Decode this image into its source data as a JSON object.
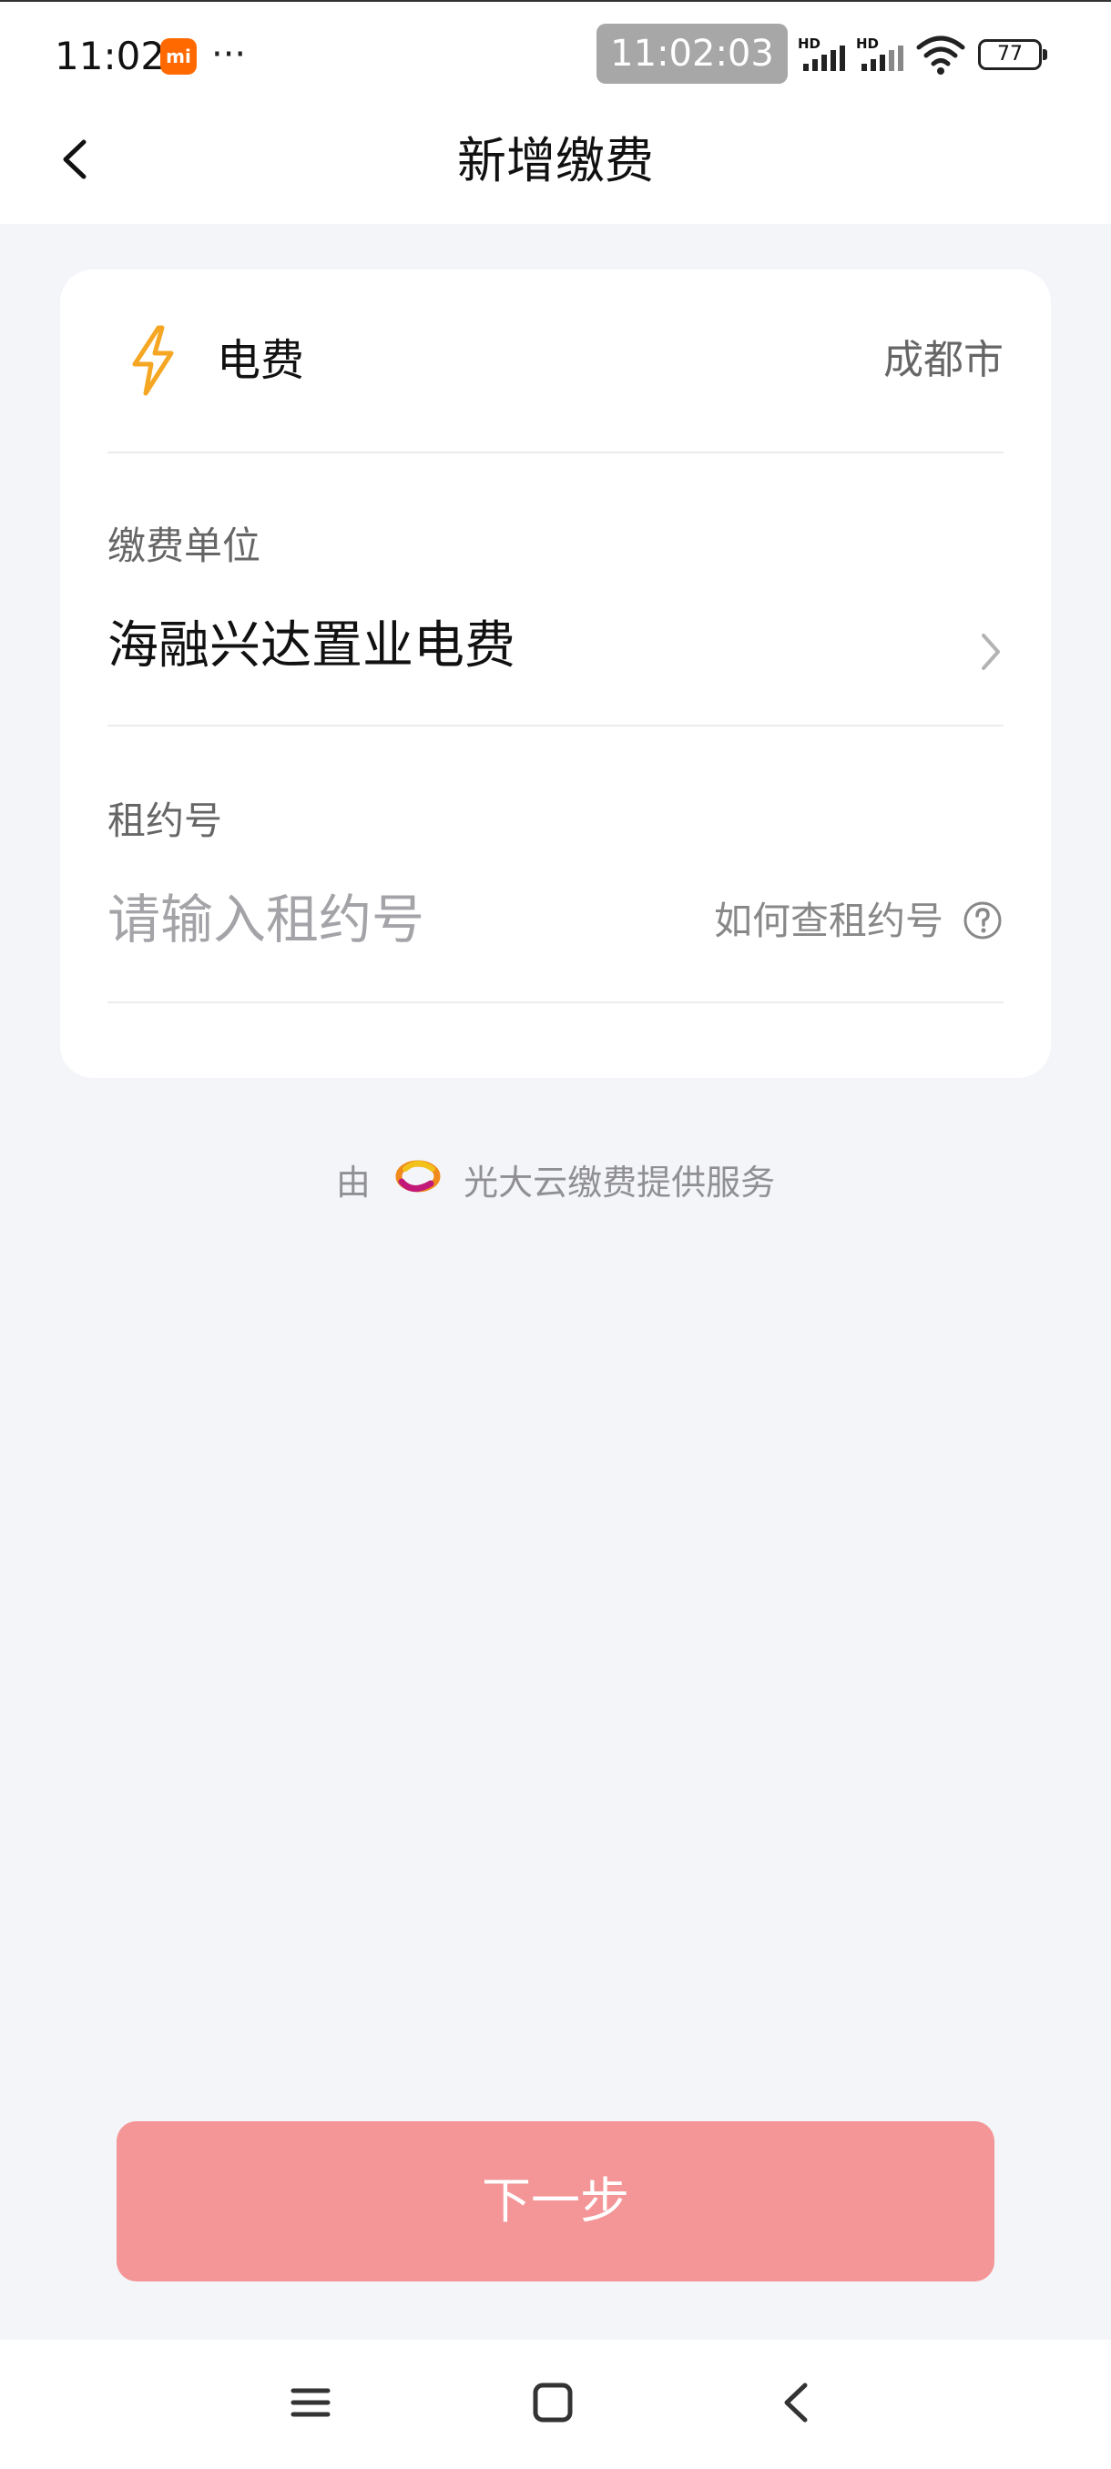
{
  "status_bar": {
    "time": "11:02",
    "mi_badge": "mi",
    "more": "···",
    "clock": "11:02:03",
    "signal_1_label": "HD",
    "signal_2_label": "HD",
    "battery": "77"
  },
  "header": {
    "title": "新增缴费"
  },
  "bill": {
    "type": "电费",
    "city": "成都市"
  },
  "company": {
    "label": "缴费单位",
    "value": "海融兴达置业电费"
  },
  "contract": {
    "label": "租约号",
    "placeholder": "请输入租约号",
    "help_link": "如何查租约号"
  },
  "provider": {
    "prefix": "由",
    "text": "光大云缴费提供服务"
  },
  "actions": {
    "next": "下一步"
  },
  "colors": {
    "accent_button": "#f49597",
    "bolt_icon": "#f5a623",
    "page_background": "#f4f5f8"
  },
  "icons": {
    "back": "chevron-left-icon",
    "bill": "lightning-bolt-icon",
    "company_arrow": "chevron-right-icon",
    "help": "question-circle-icon",
    "provider": "everbright-cloud-logo",
    "nav_menu": "menu-icon",
    "nav_home": "home-icon",
    "nav_back": "back-icon"
  }
}
